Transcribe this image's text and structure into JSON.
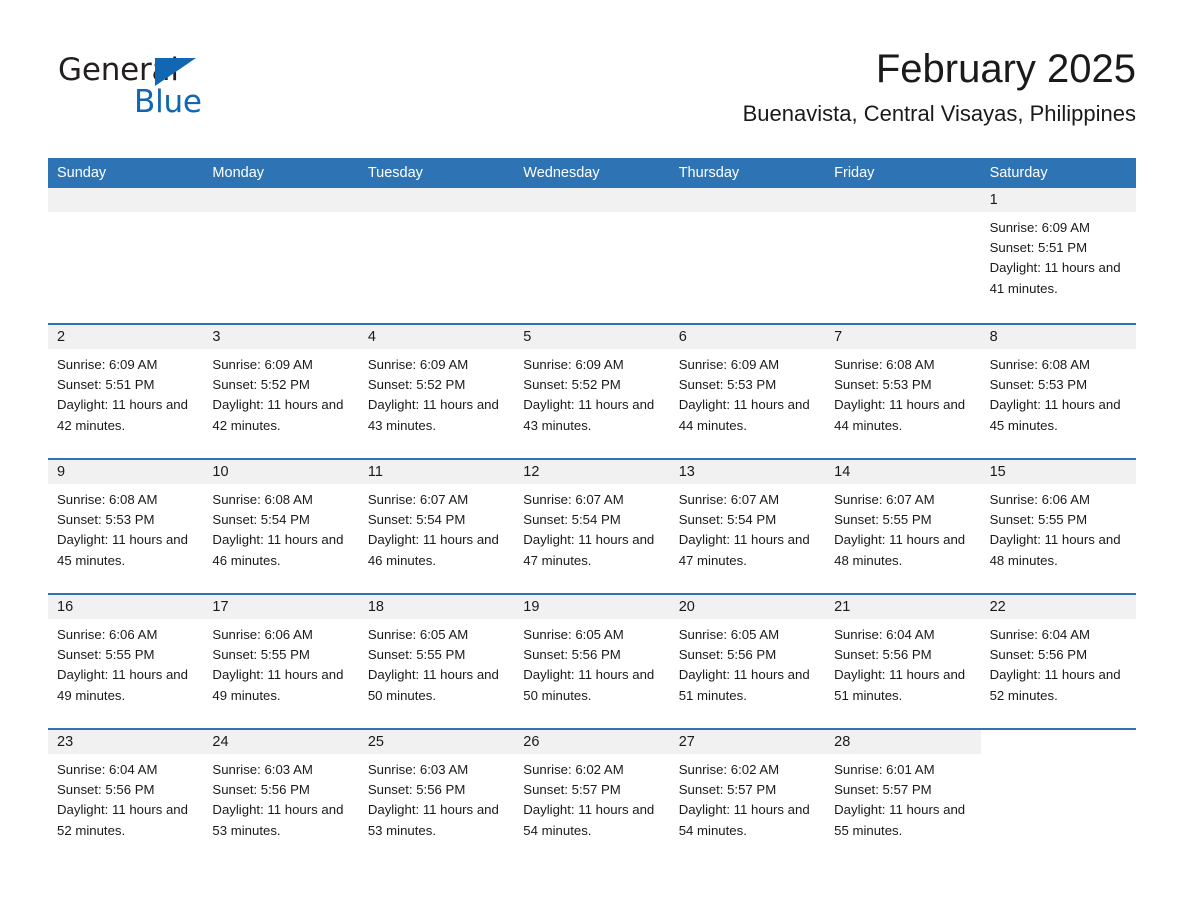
{
  "brand": {
    "name_part1": "General",
    "name_part2": "Blue",
    "triangle_icon": "triangle-icon",
    "accent_color": "#1167b1"
  },
  "header": {
    "title": "February 2025",
    "subtitle": "Buenavista, Central Visayas, Philippines"
  },
  "theme": {
    "header_bar_color": "#2e74b5",
    "day_band_color": "#f1f1f1",
    "text_color": "#1a1a1a"
  },
  "weekdays": [
    "Sunday",
    "Monday",
    "Tuesday",
    "Wednesday",
    "Thursday",
    "Friday",
    "Saturday"
  ],
  "weeks": [
    [
      {
        "empty": true
      },
      {
        "empty": true
      },
      {
        "empty": true
      },
      {
        "empty": true
      },
      {
        "empty": true
      },
      {
        "empty": true
      },
      {
        "date": "1",
        "sunrise": "Sunrise: 6:09 AM",
        "sunset": "Sunset: 5:51 PM",
        "daylight": "Daylight: 11 hours and 41 minutes."
      }
    ],
    [
      {
        "date": "2",
        "sunrise": "Sunrise: 6:09 AM",
        "sunset": "Sunset: 5:51 PM",
        "daylight": "Daylight: 11 hours and 42 minutes."
      },
      {
        "date": "3",
        "sunrise": "Sunrise: 6:09 AM",
        "sunset": "Sunset: 5:52 PM",
        "daylight": "Daylight: 11 hours and 42 minutes."
      },
      {
        "date": "4",
        "sunrise": "Sunrise: 6:09 AM",
        "sunset": "Sunset: 5:52 PM",
        "daylight": "Daylight: 11 hours and 43 minutes."
      },
      {
        "date": "5",
        "sunrise": "Sunrise: 6:09 AM",
        "sunset": "Sunset: 5:52 PM",
        "daylight": "Daylight: 11 hours and 43 minutes."
      },
      {
        "date": "6",
        "sunrise": "Sunrise: 6:09 AM",
        "sunset": "Sunset: 5:53 PM",
        "daylight": "Daylight: 11 hours and 44 minutes."
      },
      {
        "date": "7",
        "sunrise": "Sunrise: 6:08 AM",
        "sunset": "Sunset: 5:53 PM",
        "daylight": "Daylight: 11 hours and 44 minutes."
      },
      {
        "date": "8",
        "sunrise": "Sunrise: 6:08 AM",
        "sunset": "Sunset: 5:53 PM",
        "daylight": "Daylight: 11 hours and 45 minutes."
      }
    ],
    [
      {
        "date": "9",
        "sunrise": "Sunrise: 6:08 AM",
        "sunset": "Sunset: 5:53 PM",
        "daylight": "Daylight: 11 hours and 45 minutes."
      },
      {
        "date": "10",
        "sunrise": "Sunrise: 6:08 AM",
        "sunset": "Sunset: 5:54 PM",
        "daylight": "Daylight: 11 hours and 46 minutes."
      },
      {
        "date": "11",
        "sunrise": "Sunrise: 6:07 AM",
        "sunset": "Sunset: 5:54 PM",
        "daylight": "Daylight: 11 hours and 46 minutes."
      },
      {
        "date": "12",
        "sunrise": "Sunrise: 6:07 AM",
        "sunset": "Sunset: 5:54 PM",
        "daylight": "Daylight: 11 hours and 47 minutes."
      },
      {
        "date": "13",
        "sunrise": "Sunrise: 6:07 AM",
        "sunset": "Sunset: 5:54 PM",
        "daylight": "Daylight: 11 hours and 47 minutes."
      },
      {
        "date": "14",
        "sunrise": "Sunrise: 6:07 AM",
        "sunset": "Sunset: 5:55 PM",
        "daylight": "Daylight: 11 hours and 48 minutes."
      },
      {
        "date": "15",
        "sunrise": "Sunrise: 6:06 AM",
        "sunset": "Sunset: 5:55 PM",
        "daylight": "Daylight: 11 hours and 48 minutes."
      }
    ],
    [
      {
        "date": "16",
        "sunrise": "Sunrise: 6:06 AM",
        "sunset": "Sunset: 5:55 PM",
        "daylight": "Daylight: 11 hours and 49 minutes."
      },
      {
        "date": "17",
        "sunrise": "Sunrise: 6:06 AM",
        "sunset": "Sunset: 5:55 PM",
        "daylight": "Daylight: 11 hours and 49 minutes."
      },
      {
        "date": "18",
        "sunrise": "Sunrise: 6:05 AM",
        "sunset": "Sunset: 5:55 PM",
        "daylight": "Daylight: 11 hours and 50 minutes."
      },
      {
        "date": "19",
        "sunrise": "Sunrise: 6:05 AM",
        "sunset": "Sunset: 5:56 PM",
        "daylight": "Daylight: 11 hours and 50 minutes."
      },
      {
        "date": "20",
        "sunrise": "Sunrise: 6:05 AM",
        "sunset": "Sunset: 5:56 PM",
        "daylight": "Daylight: 11 hours and 51 minutes."
      },
      {
        "date": "21",
        "sunrise": "Sunrise: 6:04 AM",
        "sunset": "Sunset: 5:56 PM",
        "daylight": "Daylight: 11 hours and 51 minutes."
      },
      {
        "date": "22",
        "sunrise": "Sunrise: 6:04 AM",
        "sunset": "Sunset: 5:56 PM",
        "daylight": "Daylight: 11 hours and 52 minutes."
      }
    ],
    [
      {
        "date": "23",
        "sunrise": "Sunrise: 6:04 AM",
        "sunset": "Sunset: 5:56 PM",
        "daylight": "Daylight: 11 hours and 52 minutes."
      },
      {
        "date": "24",
        "sunrise": "Sunrise: 6:03 AM",
        "sunset": "Sunset: 5:56 PM",
        "daylight": "Daylight: 11 hours and 53 minutes."
      },
      {
        "date": "25",
        "sunrise": "Sunrise: 6:03 AM",
        "sunset": "Sunset: 5:56 PM",
        "daylight": "Daylight: 11 hours and 53 minutes."
      },
      {
        "date": "26",
        "sunrise": "Sunrise: 6:02 AM",
        "sunset": "Sunset: 5:57 PM",
        "daylight": "Daylight: 11 hours and 54 minutes."
      },
      {
        "date": "27",
        "sunrise": "Sunrise: 6:02 AM",
        "sunset": "Sunset: 5:57 PM",
        "daylight": "Daylight: 11 hours and 54 minutes."
      },
      {
        "date": "28",
        "sunrise": "Sunrise: 6:01 AM",
        "sunset": "Sunset: 5:57 PM",
        "daylight": "Daylight: 11 hours and 55 minutes."
      },
      {
        "empty": true,
        "no_band": true
      }
    ]
  ]
}
